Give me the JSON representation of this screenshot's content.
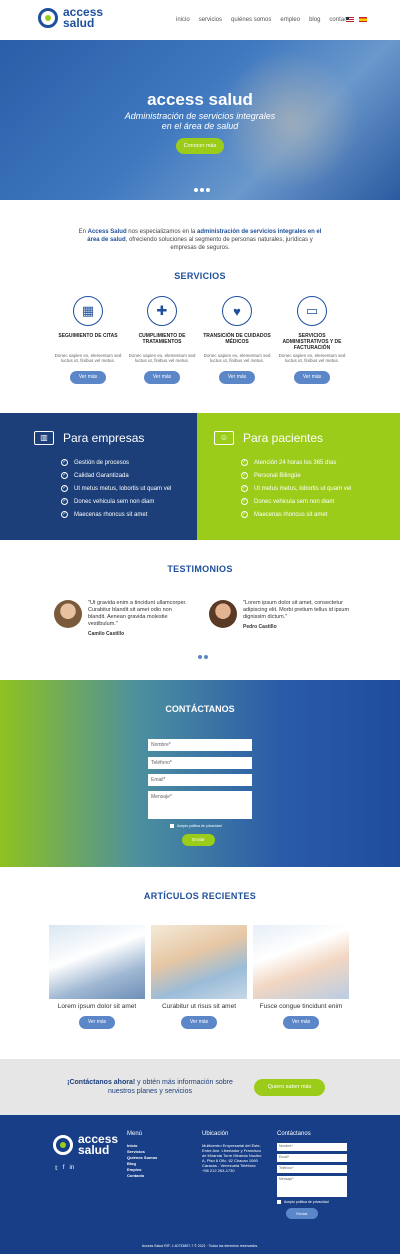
{
  "header": {
    "logo_line1": "access",
    "logo_line2": "salud",
    "nav": [
      "inicio",
      "servicios",
      "quiénes somos",
      "empleo",
      "blog",
      "contacto"
    ]
  },
  "hero": {
    "title": "access salud",
    "subtitle_line1": "Administración de servicios integrales",
    "subtitle_line2": "en el área de salud",
    "button": "Conocer más"
  },
  "intro": {
    "p1": "En ",
    "brand": "Access Salud",
    "p2": " nos especializamos en la ",
    "b1": "administración de servicios integrales en el área de salud",
    "p3": ", ofreciendo soluciones al segmento de personas naturales, jurídicas y empresas de seguros."
  },
  "services": {
    "title": "SERVICIOS",
    "items": [
      {
        "icon": "calendar-icon",
        "glyph": "▦",
        "title": "SEGUIMIENTO DE CITAS",
        "desc": "Donec sapien ex, elementum sed luctus ut, finibus vel metus.",
        "button": "Ver más"
      },
      {
        "icon": "pill-bottle-icon",
        "glyph": "✚",
        "title": "CUMPLIMIENTO DE TRATAMIENTOS",
        "desc": "Donec sapien ex, elementum sed luctus ut, finibus vel metus.",
        "button": "Ver más"
      },
      {
        "icon": "heart-hand-icon",
        "glyph": "♥",
        "title": "TRANSICIÓN DE CUIDADOS MÉDICOS",
        "desc": "Donec sapien ex, elementum sed luctus ut, finibus vel metus.",
        "button": "Ver más"
      },
      {
        "icon": "monitor-icon",
        "glyph": "▭",
        "title": "SERVICIOS ADMINISTRATIVOS Y DE FACTURACIÓN",
        "desc": "Donec sapien ex, elementum sed luctus ut, finibus vel metus.",
        "button": "Ver más"
      }
    ]
  },
  "empresas": {
    "title": "Para empresas",
    "items": [
      "Gestión de procesos",
      "Calidad Garantizada",
      "Ut metus metus, lobortis ut quam vel",
      "Donec vehicula sem non diam",
      "Maecenas rhoncus sit amet"
    ]
  },
  "pacientes": {
    "title": "Para pacientes",
    "items": [
      "Atención 24 horas los 365 días",
      "Personal Bilingüe",
      "Ut metus metus, lobortis ut quam vel",
      "Donec vehicula sem non diam",
      "Maecenas rhoncus sit amet"
    ]
  },
  "testimonials": {
    "title": "TESTIMONIOS",
    "items": [
      {
        "quote": "\"Ut gravida enim a tincidunt ullamcorper. Curabitur blandit sit amet odio non blandit. Aenean gravida molestie vestibulum.\"",
        "name": "Camilo Castillo"
      },
      {
        "quote": "\"Lorem ipsum dolor sit amet, consectetur adipiscing elit. Morbi pretium tellus id ipsum dignissim dictum.\"",
        "name": "Pedro Castillo"
      }
    ]
  },
  "contact": {
    "title": "CONTÁCTANOS",
    "fields": [
      "Nombre*",
      "Teléfono*",
      "Email*",
      "Mensaje*"
    ],
    "privacy": "Acepto política de privacidad",
    "submit": "Enviar"
  },
  "articles": {
    "title": "ARTÍCULOS RECIENTES",
    "items": [
      {
        "title": "Lorem ipsum dolor sit amet",
        "button": "Ver más"
      },
      {
        "title": "Curabitur ut risus sit amet",
        "button": "Ver más"
      },
      {
        "title": "Fusce congue tincidunt enim",
        "button": "Ver más"
      }
    ]
  },
  "cta": {
    "bold": "¡Contáctanos ahora!",
    "text": " y obtén más información sobre nuestros planes y servicios",
    "button": "Quiero saber más"
  },
  "footer": {
    "menu_title": "Menú",
    "menu": [
      "Inicio",
      "Servicios",
      "Quiénes Somos",
      "Blog",
      "Empleo",
      "Contacto"
    ],
    "location_title": "Ubicación",
    "address": "Multicentro Empresarial del Este, Entre Ave. Libertador y Francisco de Miranda Torre Miranda Nucleo A, Piso 6 Ofic. 62 Chacao 1060 Caracas - Venezuela Teléfono: +58 212 263-1730",
    "contact_title": "Contáctanos",
    "fields": [
      "Nombre*",
      "Email*",
      "Teléfono*",
      "Mensaje*"
    ],
    "privacy": "Acepto política de privacidad",
    "submit": "Enviar",
    "copyright": "Access Salud RIF: J-40733897-7 © 2021 · Todos los derechos reservados."
  },
  "colors": {
    "primary": "#1e4f9c",
    "accent": "#9ccc1a",
    "button_blue": "#5b86c8"
  }
}
